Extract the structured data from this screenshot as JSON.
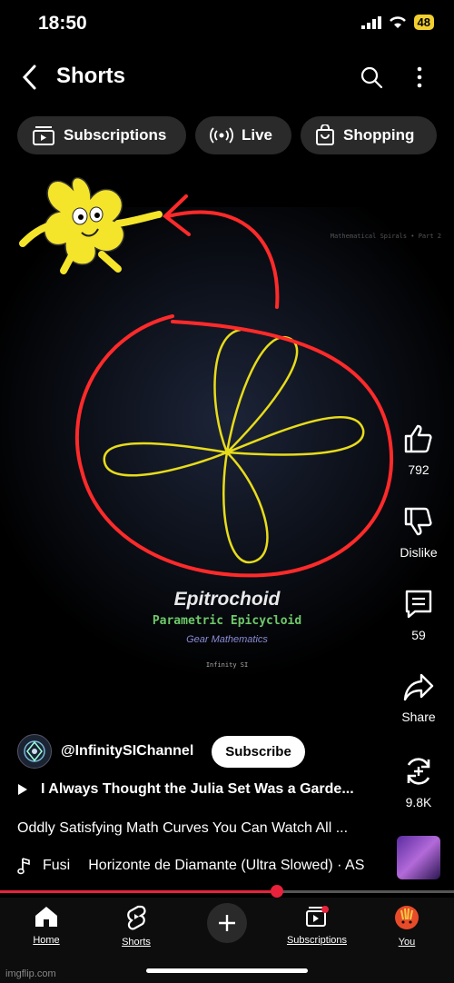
{
  "status": {
    "time": "18:50",
    "battery": "48"
  },
  "header": {
    "title": "Shorts"
  },
  "chips": [
    {
      "label": "Subscriptions",
      "icon": "subscriptions-icon"
    },
    {
      "label": "Live",
      "icon": "live-icon"
    },
    {
      "label": "Shopping",
      "icon": "shopping-bag-icon"
    }
  ],
  "video": {
    "watermark_top": "Mathematical Spirals • Part 2",
    "title": "Epitrochoid",
    "subtitle": "Parametric Epicycloid",
    "subtitle2": "Gear Mathematics",
    "credit": "Infinity SI"
  },
  "actions": {
    "like_count": "792",
    "dislike_label": "Dislike",
    "comments_count": "59",
    "share_label": "Share",
    "remix_count": "9.8K"
  },
  "channel": {
    "name": "@InfinitySIChannel",
    "subscribe_label": "Subscribe"
  },
  "related_title": "I Always Thought the Julia Set Was a Garde...",
  "description": "Oddly Satisfying Math Curves You Can Watch All ...",
  "music": {
    "prefix": "Fusi",
    "track": "Horizonte de Diamante (Ultra Slowed) · AS"
  },
  "progress": 0.61,
  "nav": [
    {
      "label": "Home",
      "icon": "home-icon"
    },
    {
      "label": "Shorts",
      "icon": "shorts-icon"
    },
    {
      "label": "Subscriptions",
      "icon": "subscriptions-icon"
    },
    {
      "label": "You",
      "icon": "profile-avatar-icon"
    }
  ],
  "footer_watermark": "imgflip.com",
  "colors": {
    "accent": "#e8223b",
    "curve": "#e8dc1a",
    "annotation": "#ff2a2a",
    "chip_bg": "#2a2a2a"
  }
}
